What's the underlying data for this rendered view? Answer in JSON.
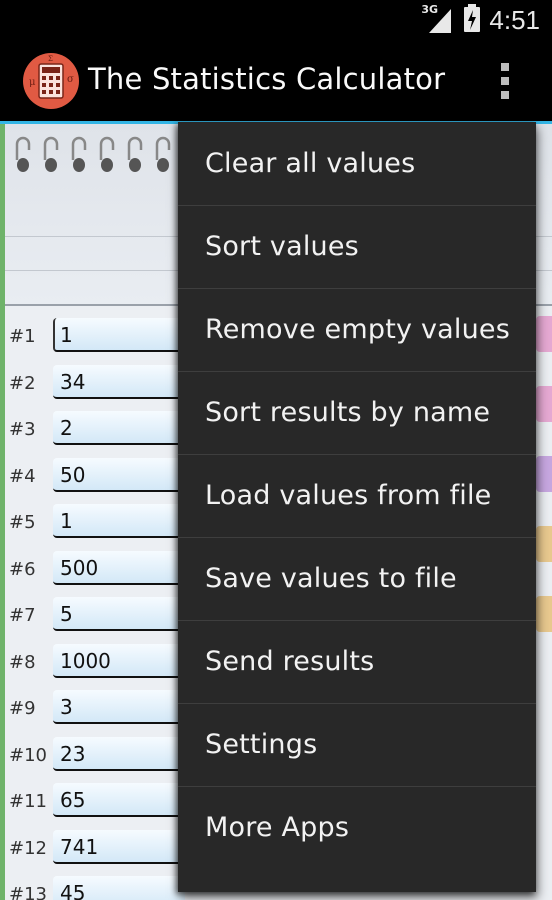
{
  "status_bar": {
    "network_label": "3G",
    "time": "4:51"
  },
  "action_bar": {
    "title": "The Statistics Calculator",
    "icon": "calculator-icon"
  },
  "values": [
    {
      "index": "#1",
      "value": "1"
    },
    {
      "index": "#2",
      "value": "34"
    },
    {
      "index": "#3",
      "value": "2"
    },
    {
      "index": "#4",
      "value": "50"
    },
    {
      "index": "#5",
      "value": "1"
    },
    {
      "index": "#6",
      "value": "500"
    },
    {
      "index": "#7",
      "value": "5"
    },
    {
      "index": "#8",
      "value": "1000"
    },
    {
      "index": "#9",
      "value": "3"
    },
    {
      "index": "#10",
      "value": "23"
    },
    {
      "index": "#11",
      "value": "65"
    },
    {
      "index": "#12",
      "value": "741"
    },
    {
      "index": "#13",
      "value": "45"
    }
  ],
  "menu": {
    "items": [
      {
        "label": "Clear all values"
      },
      {
        "label": "Sort values"
      },
      {
        "label": "Remove empty values"
      },
      {
        "label": "Sort results by name"
      },
      {
        "label": "Load values from file"
      },
      {
        "label": "Save values to file"
      },
      {
        "label": "Send results"
      },
      {
        "label": "Settings"
      },
      {
        "label": "More Apps"
      }
    ]
  },
  "colors": {
    "accent": "#33b5e5",
    "icon_red": "#e05a43",
    "menu_bg": "#282828"
  }
}
